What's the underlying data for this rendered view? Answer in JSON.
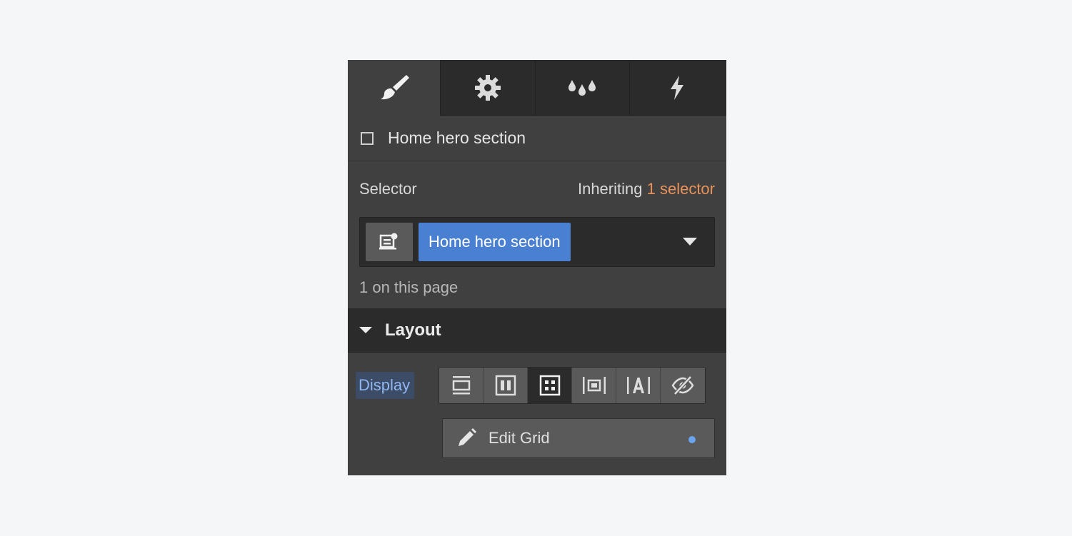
{
  "tabs": [
    {
      "name": "style",
      "icon": "paintbrush-icon",
      "active": true
    },
    {
      "name": "settings",
      "icon": "gear-icon",
      "active": false
    },
    {
      "name": "style-manager",
      "icon": "droplets-icon",
      "active": false
    },
    {
      "name": "interactions",
      "icon": "lightning-icon",
      "active": false
    }
  ],
  "element": {
    "name": "Home hero section"
  },
  "selector": {
    "label": "Selector",
    "inheriting_label": "Inheriting",
    "inheriting_count": "1 selector",
    "tag": "Home hero section",
    "on_page": "1 on this page"
  },
  "layout": {
    "title": "Layout",
    "display_label": "Display",
    "display_options": [
      "block",
      "flex",
      "grid",
      "inline-block",
      "inline",
      "none"
    ],
    "active_display": "grid",
    "edit_grid_label": "Edit Grid"
  },
  "colors": {
    "accent": "#4a80d1",
    "inherit": "#e8925a",
    "dot": "#6aa3ef"
  }
}
